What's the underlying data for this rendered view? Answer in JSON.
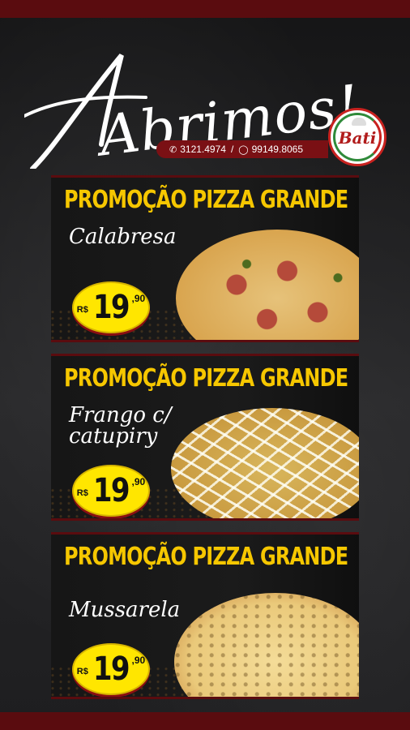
{
  "headline": "Abrimos!",
  "contact": {
    "phone_icon": "phone-icon",
    "phone": "3121.4974",
    "separator": "/",
    "whatsapp_icon": "whatsapp-icon",
    "whatsapp": "99149.8065"
  },
  "logo": {
    "name": "Bati"
  },
  "colors": {
    "accent": "#f6c700",
    "brand_red": "#5a0c0f",
    "price_bg": "#ffe600"
  },
  "promos": [
    {
      "title": "PROMOÇÃO PIZZA GRANDE",
      "flavor": "Calabresa",
      "currency": "R$",
      "price_int": "19",
      "price_dec": ",90"
    },
    {
      "title": "PROMOÇÃO PIZZA GRANDE",
      "flavor": "Frango c/ catupiry",
      "currency": "R$",
      "price_int": "19",
      "price_dec": ",90"
    },
    {
      "title": "PROMOÇÃO PIZZA GRANDE",
      "flavor": "Mussarela",
      "currency": "R$",
      "price_int": "19",
      "price_dec": ",90"
    }
  ]
}
